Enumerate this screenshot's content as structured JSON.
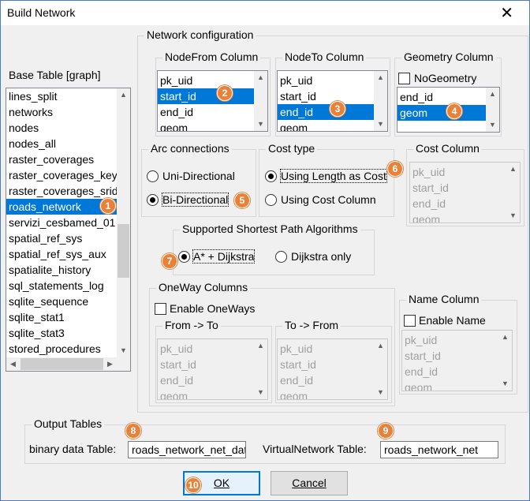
{
  "window": {
    "title": "Build Network",
    "close_glyph": "✕"
  },
  "network_configuration": {
    "label": "Network configuration"
  },
  "base_table": {
    "label": "Base Table [graph]",
    "items": [
      "lines_split",
      "networks",
      "nodes",
      "nodes_all",
      "raster_coverages",
      "raster_coverages_key",
      "raster_coverages_srid",
      "roads_network",
      "servizi_cesbamed_01",
      "spatial_ref_sys",
      "spatial_ref_sys_aux",
      "spatialite_history",
      "sql_statements_log",
      "sqlite_sequence",
      "sqlite_stat1",
      "sqlite_stat3",
      "stored_procedures"
    ],
    "selected": "roads_network"
  },
  "nodefrom": {
    "label": "NodeFrom Column",
    "items": [
      "pk_uid",
      "start_id",
      "end_id",
      "geom"
    ],
    "selected": "start_id"
  },
  "nodeto": {
    "label": "NodeTo Column",
    "items": [
      "pk_uid",
      "start_id",
      "end_id",
      "geom"
    ],
    "selected": "end_id"
  },
  "geometry": {
    "label": "Geometry Column",
    "nogeometry_label": "NoGeometry",
    "items": [
      "end_id",
      "geom"
    ],
    "selected": "geom"
  },
  "arc": {
    "label": "Arc connections",
    "options": [
      "Uni-Directional",
      "Bi-Directional"
    ],
    "selected": "Bi-Directional"
  },
  "cost_type": {
    "label": "Cost type",
    "options": [
      "Using Length as Cost",
      "Using Cost Column"
    ],
    "selected": "Using Length as Cost"
  },
  "cost_column": {
    "label": "Cost Column",
    "items": [
      "pk_uid",
      "start_id",
      "end_id",
      "geom"
    ]
  },
  "algorithms": {
    "label": "Supported Shortest Path Algorithms",
    "options": [
      "A* + Dijkstra",
      "Dijkstra only"
    ],
    "selected": "A* + Dijkstra"
  },
  "oneway": {
    "label": "OneWay Columns",
    "enable_label": "Enable OneWays",
    "from_label": "From -> To",
    "to_label": "To -> From",
    "from_items": [
      "pk_uid",
      "start_id",
      "end_id",
      "geom"
    ],
    "to_items": [
      "pk_uid",
      "start_id",
      "end_id",
      "geom"
    ]
  },
  "name_column": {
    "label": "Name Column",
    "enable_label": "Enable Name",
    "items": [
      "pk_uid",
      "start_id",
      "end_id",
      "geom"
    ]
  },
  "output": {
    "label": "Output Tables",
    "binary_label": "binary data Table:",
    "binary_value": "roads_network_net_data",
    "virtual_label": "VirtualNetwork Table:",
    "virtual_value": "roads_network_net"
  },
  "buttons": {
    "ok": "OK",
    "cancel": "Cancel"
  },
  "badges": [
    "1",
    "2",
    "3",
    "4",
    "5",
    "6",
    "7",
    "8",
    "9",
    "10"
  ],
  "colors": {
    "selection": "#0078d7",
    "badge": "#e8823a",
    "window_border": "#4a7fb5"
  }
}
